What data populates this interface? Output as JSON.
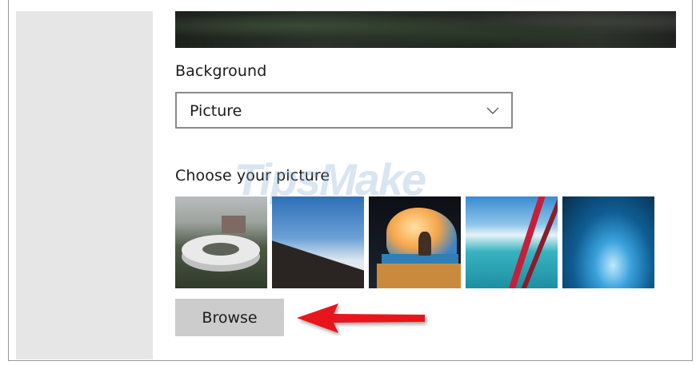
{
  "background": {
    "label": "Background",
    "selected": "Picture"
  },
  "picture": {
    "label": "Choose your picture",
    "thumbnails": [
      {
        "name": "stadium-aerial"
      },
      {
        "name": "mountain-clouds"
      },
      {
        "name": "cave-beach"
      },
      {
        "name": "airplane-wing-ocean"
      },
      {
        "name": "ice-cave"
      }
    ],
    "browse_label": "Browse"
  },
  "watermark": "TipsMake",
  "icons": {
    "dropdown": "chevron-down-icon",
    "annotation": "red-arrow-left"
  },
  "colors": {
    "sidebar": "#e6e6e6",
    "button": "#cccccc",
    "dropdown_border": "#8a8a8a",
    "arrow": "#e8141a"
  }
}
